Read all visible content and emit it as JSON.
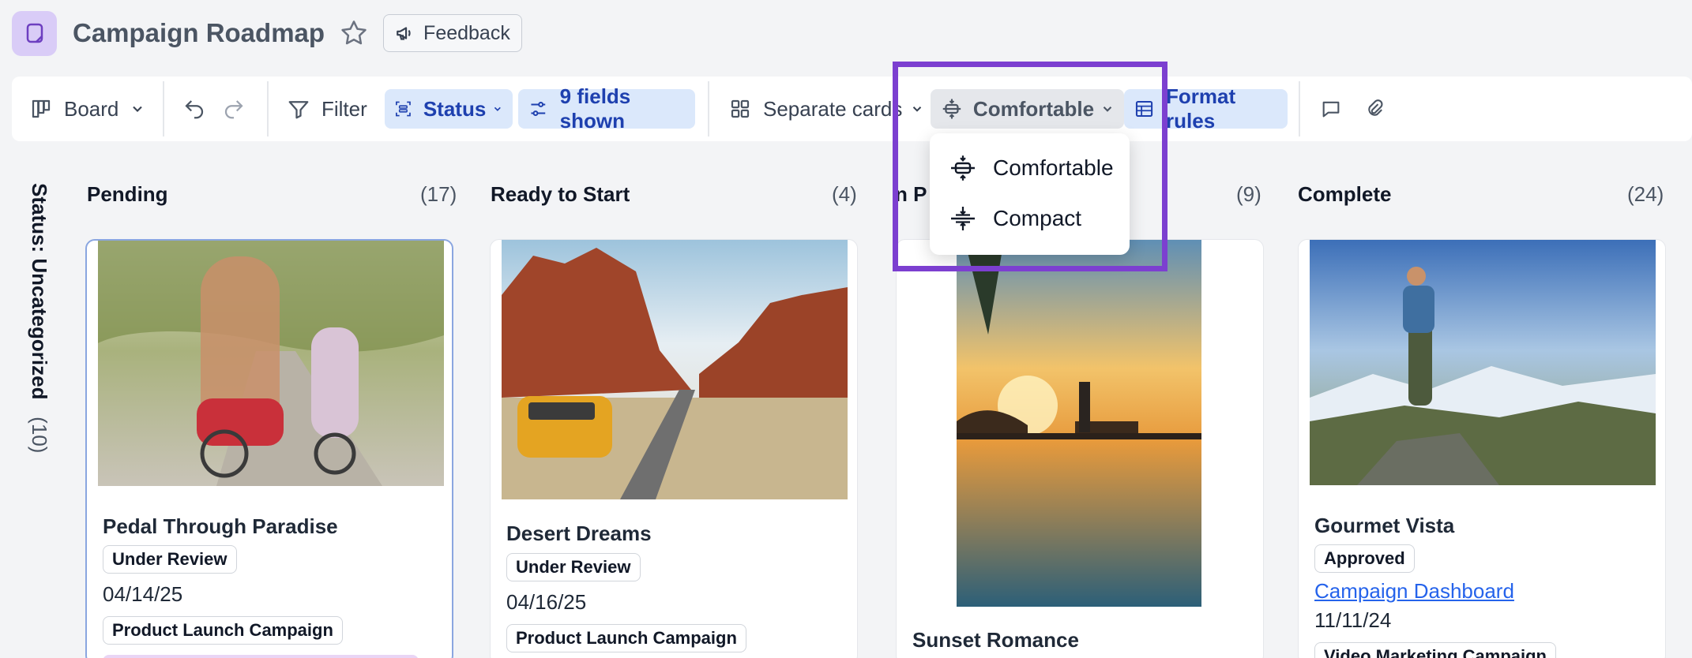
{
  "header": {
    "title": "Campaign Roadmap",
    "feedback_label": "Feedback"
  },
  "toolbar": {
    "view_label": "Board",
    "filter_label": "Filter",
    "group_label": "Status",
    "fields_label": "9 fields shown",
    "cards_label": "Separate cards",
    "density_label": "Comfortable",
    "format_label": "Format rules"
  },
  "density_menu": {
    "items": [
      {
        "label": "Comfortable"
      },
      {
        "label": "Compact"
      }
    ]
  },
  "side_group": {
    "label": "Status: Uncategorized",
    "count": "(10)"
  },
  "columns": [
    {
      "title": "Pending",
      "count": "(17)",
      "card": {
        "name": "Pedal Through Paradise",
        "status": "Under Review",
        "date": "04/14/25",
        "campaign": "Product Launch Campaign"
      }
    },
    {
      "title": "Ready to Start",
      "count": "(4)",
      "card": {
        "name": "Desert Dreams",
        "status": "Under Review",
        "date": "04/16/25",
        "campaign": "Product Launch Campaign"
      }
    },
    {
      "title": "n P",
      "count": "(9)",
      "card": {
        "name": "Sunset Romance"
      }
    },
    {
      "title": "Complete",
      "count": "(24)",
      "card": {
        "name": "Gourmet Vista",
        "status": "Approved",
        "link": "Campaign Dashboard",
        "date": "11/11/24",
        "campaign": "Video Marketing Campaign"
      }
    }
  ],
  "colors": {
    "accent": "#7c3fd0",
    "pill_blue": "#dbe8fb",
    "pill_text": "#1e40af",
    "link": "#2563eb"
  }
}
